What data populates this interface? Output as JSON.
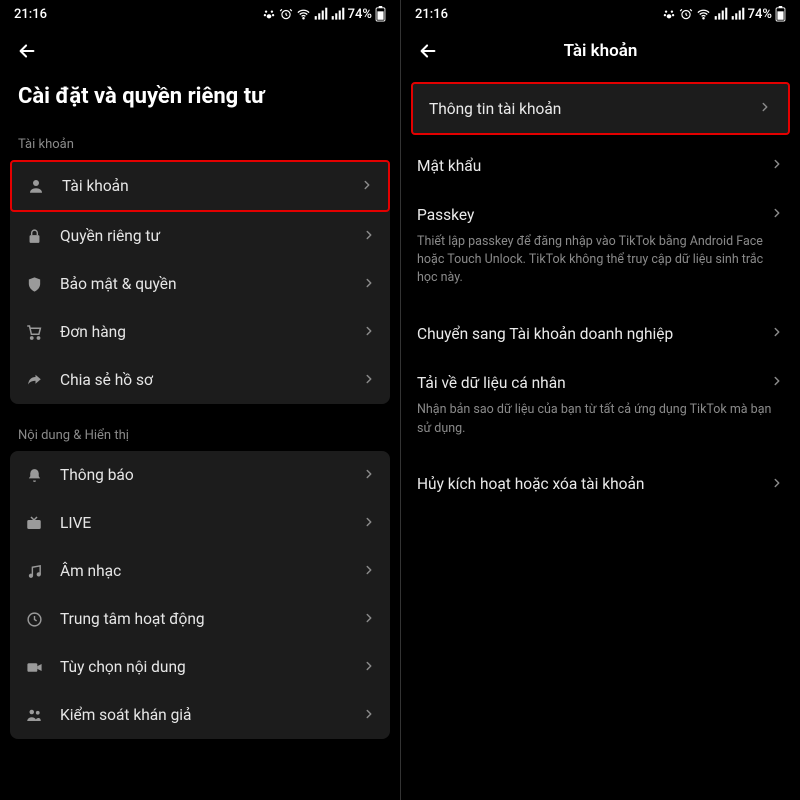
{
  "status": {
    "time": "21:16",
    "battery": "74%"
  },
  "left": {
    "pageTitle": "Cài đặt và quyền riêng tư",
    "section1": "Tài khoản",
    "section2": "Nội dung & Hiển thị",
    "rows1": {
      "account": "Tài khoản",
      "privacy": "Quyền riêng tư",
      "security": "Bảo mật & quyền",
      "orders": "Đơn hàng",
      "share": "Chia sẻ hồ sơ"
    },
    "rows2": {
      "notifications": "Thông báo",
      "live": "LIVE",
      "music": "Âm nhạc",
      "activity": "Trung tâm hoạt động",
      "contentPrefs": "Tùy chọn nội dung",
      "audience": "Kiểm soát khán giả"
    }
  },
  "right": {
    "headerTitle": "Tài khoản",
    "rows": {
      "accountInfo": "Thông tin tài khoản",
      "password": "Mật khẩu",
      "passkey": "Passkey",
      "passkeyDesc": "Thiết lập passkey để đăng nhập vào TikTok bằng Android Face hoặc Touch Unlock. TikTok không thể truy cập dữ liệu sinh trắc học này.",
      "business": "Chuyển sang Tài khoản doanh nghiệp",
      "download": "Tải về dữ liệu cá nhân",
      "downloadDesc": "Nhận bản sao dữ liệu của bạn từ tất cả ứng dụng TikTok mà bạn sử dụng.",
      "deactivate": "Hủy kích hoạt hoặc xóa tài khoản"
    }
  }
}
